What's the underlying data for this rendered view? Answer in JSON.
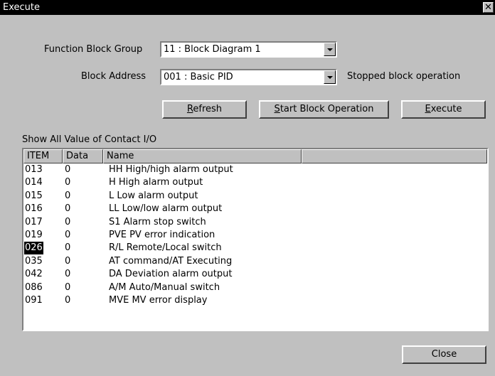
{
  "window": {
    "title": "Execute",
    "close_glyph": "✕"
  },
  "form": {
    "group_label": "Function Block Group",
    "group_value": "11 : Block Diagram 1",
    "address_label": "Block Address",
    "address_value": "001 : Basic PID",
    "status_text": "Stopped block operation"
  },
  "buttons": {
    "refresh_prefix": "",
    "refresh_ul": "R",
    "refresh_rest": "efresh",
    "start_ul": "S",
    "start_rest": "tart Block Operation",
    "execute_ul": "E",
    "execute_rest": "xecute",
    "close": "Close"
  },
  "section_label": "Show All Value of Contact I/O",
  "table": {
    "columns": [
      "ITEM",
      "Data",
      "Name",
      ""
    ],
    "selected_item": "026",
    "rows": [
      {
        "item": "013",
        "data": "0",
        "name": "HH High/high alarm output"
      },
      {
        "item": "014",
        "data": "0",
        "name": "H High alarm output"
      },
      {
        "item": "015",
        "data": "0",
        "name": "L Low alarm output"
      },
      {
        "item": "016",
        "data": "0",
        "name": "LL Low/low alarm output"
      },
      {
        "item": "017",
        "data": "0",
        "name": "S1 Alarm stop switch"
      },
      {
        "item": "019",
        "data": "0",
        "name": "PVE PV error indication"
      },
      {
        "item": "026",
        "data": "0",
        "name": "R/L Remote/Local switch"
      },
      {
        "item": "035",
        "data": "0",
        "name": " AT command/AT Executing"
      },
      {
        "item": "042",
        "data": "0",
        "name": "DA Deviation alarm output"
      },
      {
        "item": "086",
        "data": "0",
        "name": "A/M Auto/Manual switch"
      },
      {
        "item": "091",
        "data": "0",
        "name": "MVE MV error display"
      }
    ]
  }
}
